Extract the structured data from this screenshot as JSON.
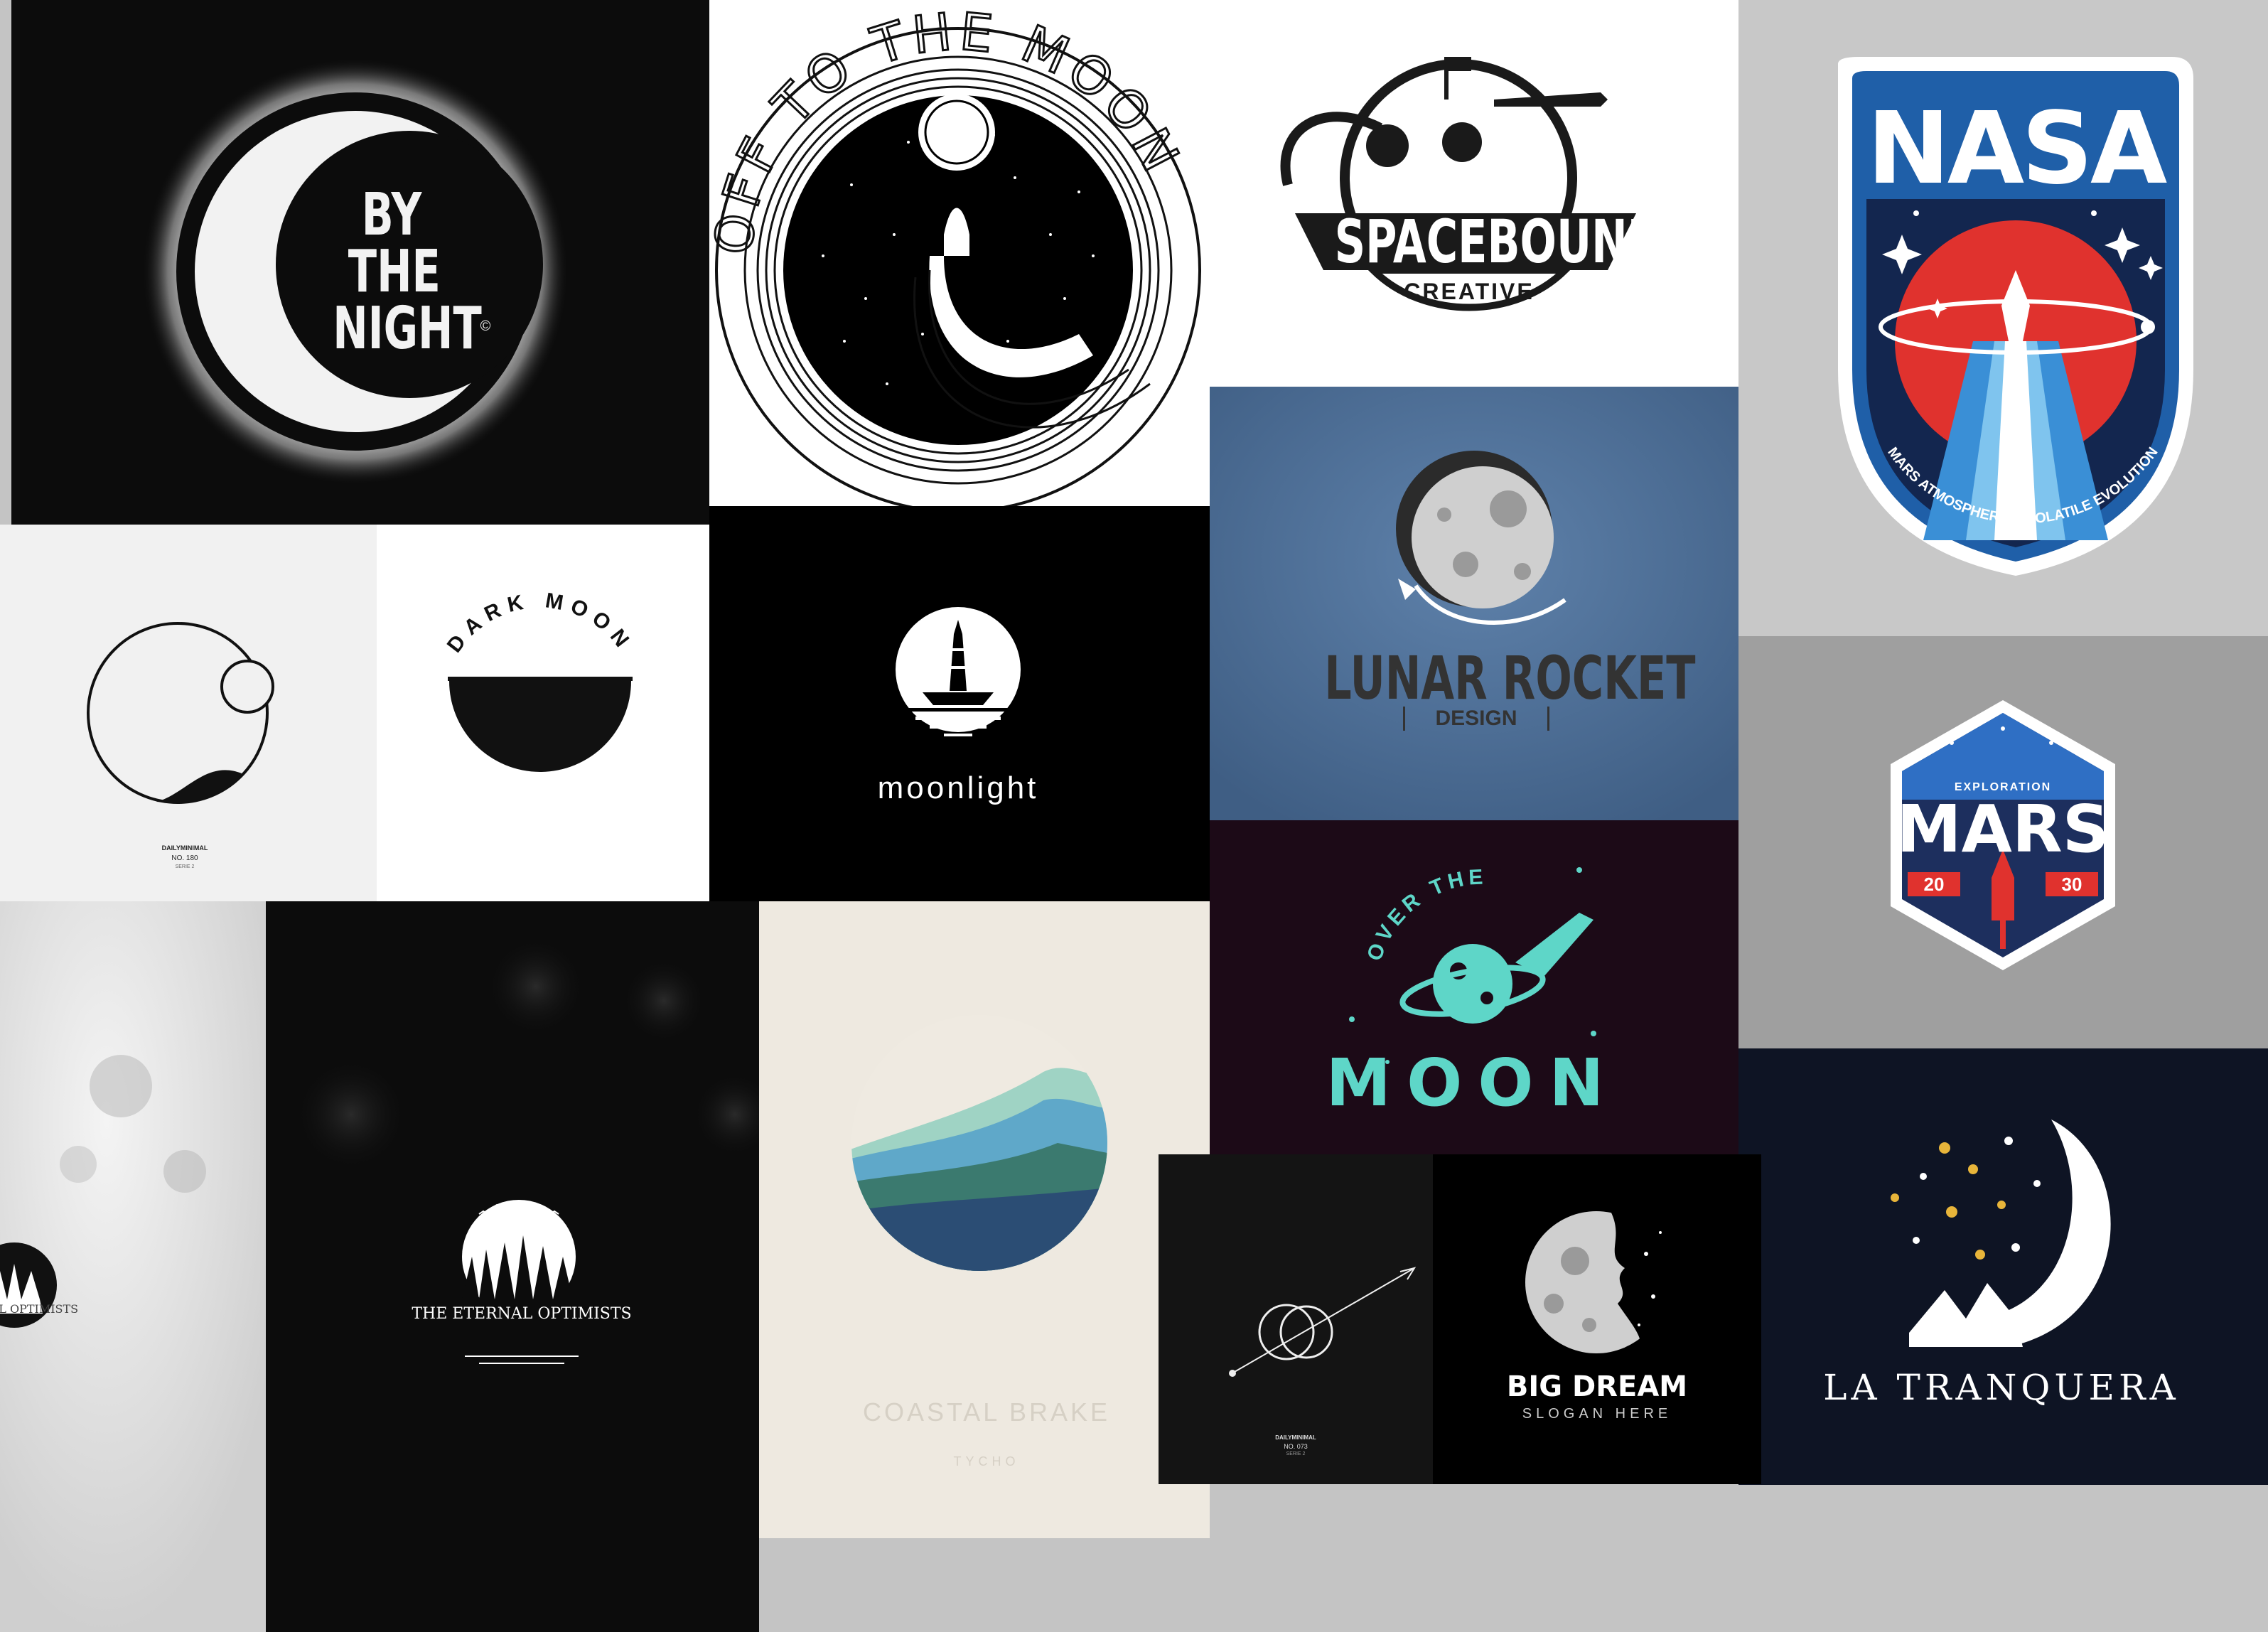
{
  "logos": {
    "by_the_night": {
      "line1": "BY",
      "line2": "THE",
      "line3": "NIGHT",
      "mark": "©"
    },
    "off_to_the_moon": {
      "ring_text": "OFF TO THE MOON"
    },
    "spacebound": {
      "name": "SPACEBOUND",
      "sub": "CREATIVE"
    },
    "nasa": {
      "wordmark": "NASA",
      "ring_text": "MARS ATMOSPHERE & VOLATILE EVOLUTION"
    },
    "dailyminimal_180": {
      "brand": "DAILYMINIMAL",
      "number": "NO. 180",
      "sub": "SERIE 2"
    },
    "dark_moon": {
      "title": "DARK MOON"
    },
    "moonlight": {
      "title": "moonlight"
    },
    "lunar_rocket": {
      "title": "LUNAR ROCKET",
      "sub": "DESIGN"
    },
    "mars": {
      "small": "EXPLORATION",
      "title": "MARS",
      "year_left": "20",
      "year_right": "30"
    },
    "over_the_moon": {
      "arc": "OVER THE",
      "title": "MOON"
    },
    "eternal_left": {
      "title": "E ETERNAL OPTIMISTS"
    },
    "eternal": {
      "title": "THE ETERNAL OPTIMISTS"
    },
    "coastal": {
      "title": "COASTAL BRAKE",
      "sub": "TYCHO"
    },
    "dailyminimal_073": {
      "brand": "DAILYMINIMAL",
      "number": "NO. 073",
      "sub": "SERIE 2"
    },
    "big_dream": {
      "title": "BIG DREAM",
      "sub": "SLOGAN HERE"
    },
    "la_tranquera": {
      "title": "LA TRANQUERA"
    }
  },
  "colors": {
    "page_bg": "#c4c4c4",
    "teal": "#5ed6c8",
    "nasa_blue": "#1f5fa8",
    "nasa_navy": "#13264f",
    "nasa_red": "#e0322e",
    "lunar_bg": "#4b6c93",
    "over_moon_bg": "#1c0a17",
    "tranquera_bg": "#0e1424",
    "star_gold": "#e8b53a"
  }
}
